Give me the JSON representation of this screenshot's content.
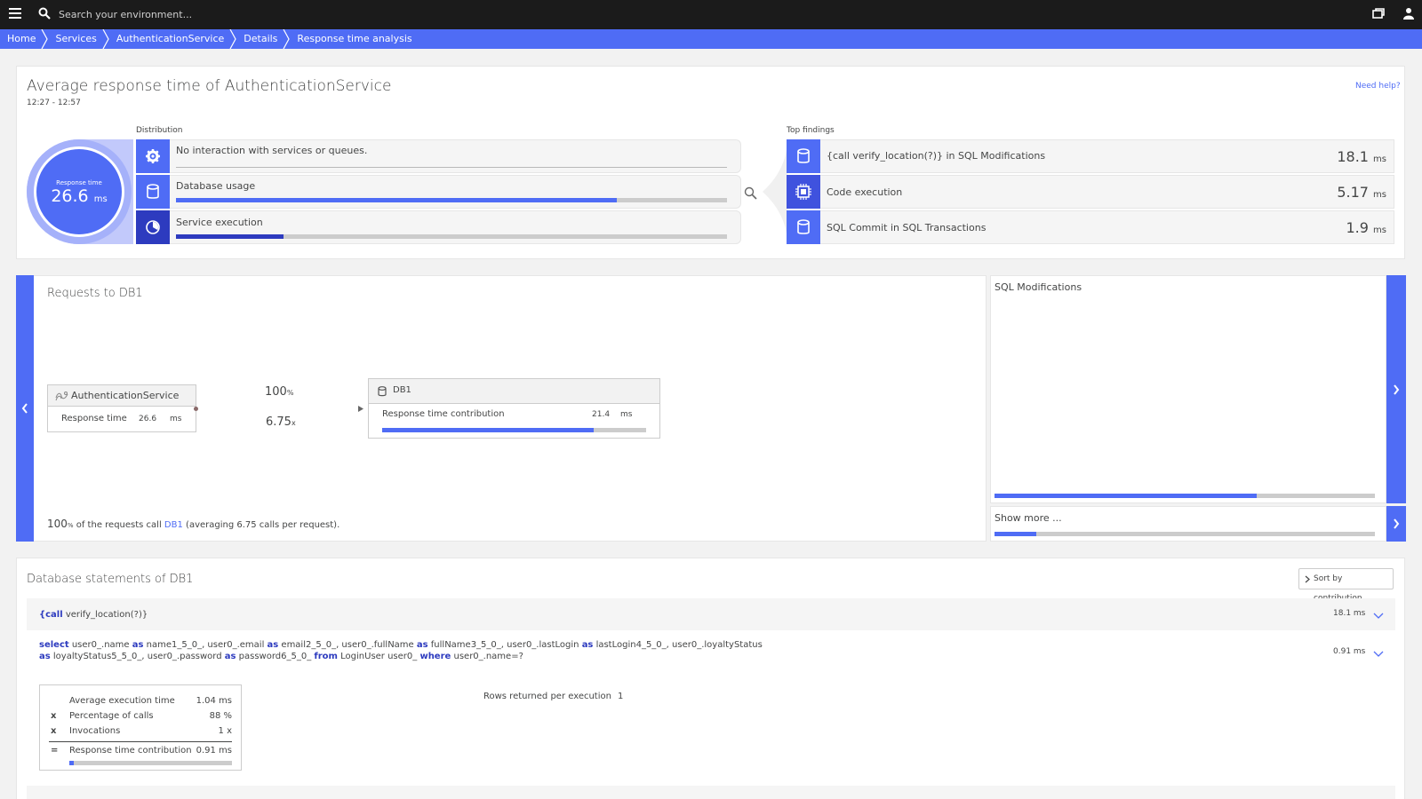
{
  "topbar": {
    "search_placeholder": "Search your environment...",
    "icons": [
      "menu-icon",
      "search-icon",
      "window-icon",
      "user-icon"
    ]
  },
  "breadcrumb": [
    "Home",
    "Services",
    "AuthenticationService",
    "Details",
    "Response time analysis"
  ],
  "summary": {
    "title": "Average response time of AuthenticationService",
    "time_range": "12:27 - 12:57",
    "help_link": "Need help?",
    "response_time_label": "Response time",
    "response_time_value": "26.6",
    "response_time_unit": "ms",
    "distribution_label": "Distribution",
    "distribution": [
      {
        "icon": "gear-icon",
        "label": "No interaction with services or queues.",
        "share": 0
      },
      {
        "icon": "database-icon",
        "label": "Database usage",
        "share": 0.8
      },
      {
        "icon": "timer-icon",
        "label": "Service execution",
        "share": 0.195
      }
    ],
    "top_findings_label": "Top findings",
    "top_findings": [
      {
        "icon": "database-icon",
        "label": "{call verify_location(?)} in SQL Modifications",
        "value": "18.1",
        "unit": "ms"
      },
      {
        "icon": "cpu-icon",
        "label": "Code execution",
        "value": "5.17",
        "unit": "ms"
      },
      {
        "icon": "database-icon",
        "label": "SQL Commit in SQL Transactions",
        "value": "1.9",
        "unit": "ms"
      }
    ]
  },
  "requests": {
    "title": "Requests to DB1",
    "source": {
      "name": "AuthenticationService",
      "metric_label": "Response time",
      "metric_value": "26.6",
      "metric_unit": "ms"
    },
    "percent_value": "100",
    "percent_unit": "%",
    "calls_value": "6.75",
    "calls_unit": "x",
    "target": {
      "name": "DB1",
      "metric_label": "Response time contribution",
      "metric_value": "21.4",
      "metric_unit": "ms",
      "share": 0.8
    },
    "footer": {
      "pct": "100",
      "pct_unit": "%",
      "text_before": " of the requests call ",
      "link": "DB1",
      "text_after": " (averaging 6.75 calls per request)."
    }
  },
  "side": {
    "title": "SQL Modifications",
    "share": 0.69,
    "show_more": "Show more ...",
    "show_more_share": 0.11
  },
  "statements": {
    "title": "Database statements of DB1",
    "sort_button": "Sort by contribution",
    "rows": [
      {
        "call_kw": "{call",
        "call_rest": " verify_location(?)}",
        "value": "18.1 ms"
      },
      {
        "value": "0.91 ms"
      }
    ],
    "sql": {
      "select": "select",
      "p1": " user0_.name ",
      "as1": "as",
      "p2": " name1_5_0_, user0_.email ",
      "as2": "as",
      "p3": " email2_5_0_, user0_.fullName ",
      "as3": "as",
      "p4": " fullName3_5_0_, user0_.lastLogin ",
      "as4": "as",
      "p5": " lastLogin4_5_0_, user0_.loyaltyStatus",
      "as5": "as",
      "p6": " loyaltyStatus5_5_0_, user0_.password ",
      "as6": "as",
      "p7": " password6_5_0_ ",
      "from": "from",
      "p8": " LoginUser user0_ ",
      "where": "where",
      "p9": " user0_.name=?"
    },
    "stats": [
      {
        "op": "",
        "name": "Average execution time",
        "value": "1.04 ms"
      },
      {
        "op": "x",
        "name": "Percentage of calls",
        "value": "88 %"
      },
      {
        "op": "x",
        "name": "Invocations",
        "value": "1 x"
      },
      {
        "op": "=",
        "name": "Response time contribution",
        "value": "0.91 ms"
      }
    ],
    "stats_share": 0.03,
    "rows_returned_label": "Rows returned per execution",
    "rows_returned_value": "1"
  }
}
